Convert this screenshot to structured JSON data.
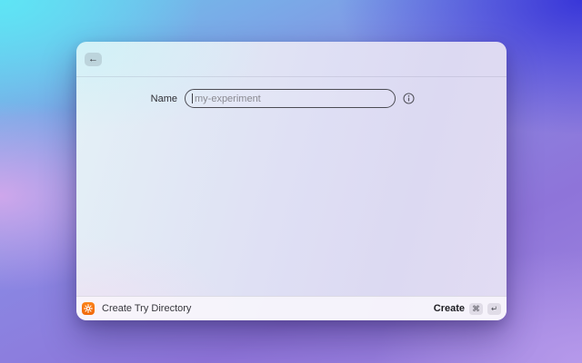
{
  "header": {
    "back_icon_glyph": "←"
  },
  "form": {
    "name_label": "Name",
    "name_input": {
      "value": "",
      "placeholder": "my-experiment"
    },
    "info_icon": "info-icon"
  },
  "footer": {
    "app_icon": "gear-icon",
    "context_label": "Create Try Directory",
    "submit_label": "Create",
    "shortcut_keys": [
      "⌘",
      "↵"
    ]
  },
  "colors": {
    "accent_orange": "#F97316",
    "input_border": "#4C4C54",
    "placeholder_text": "#8A8A92"
  }
}
